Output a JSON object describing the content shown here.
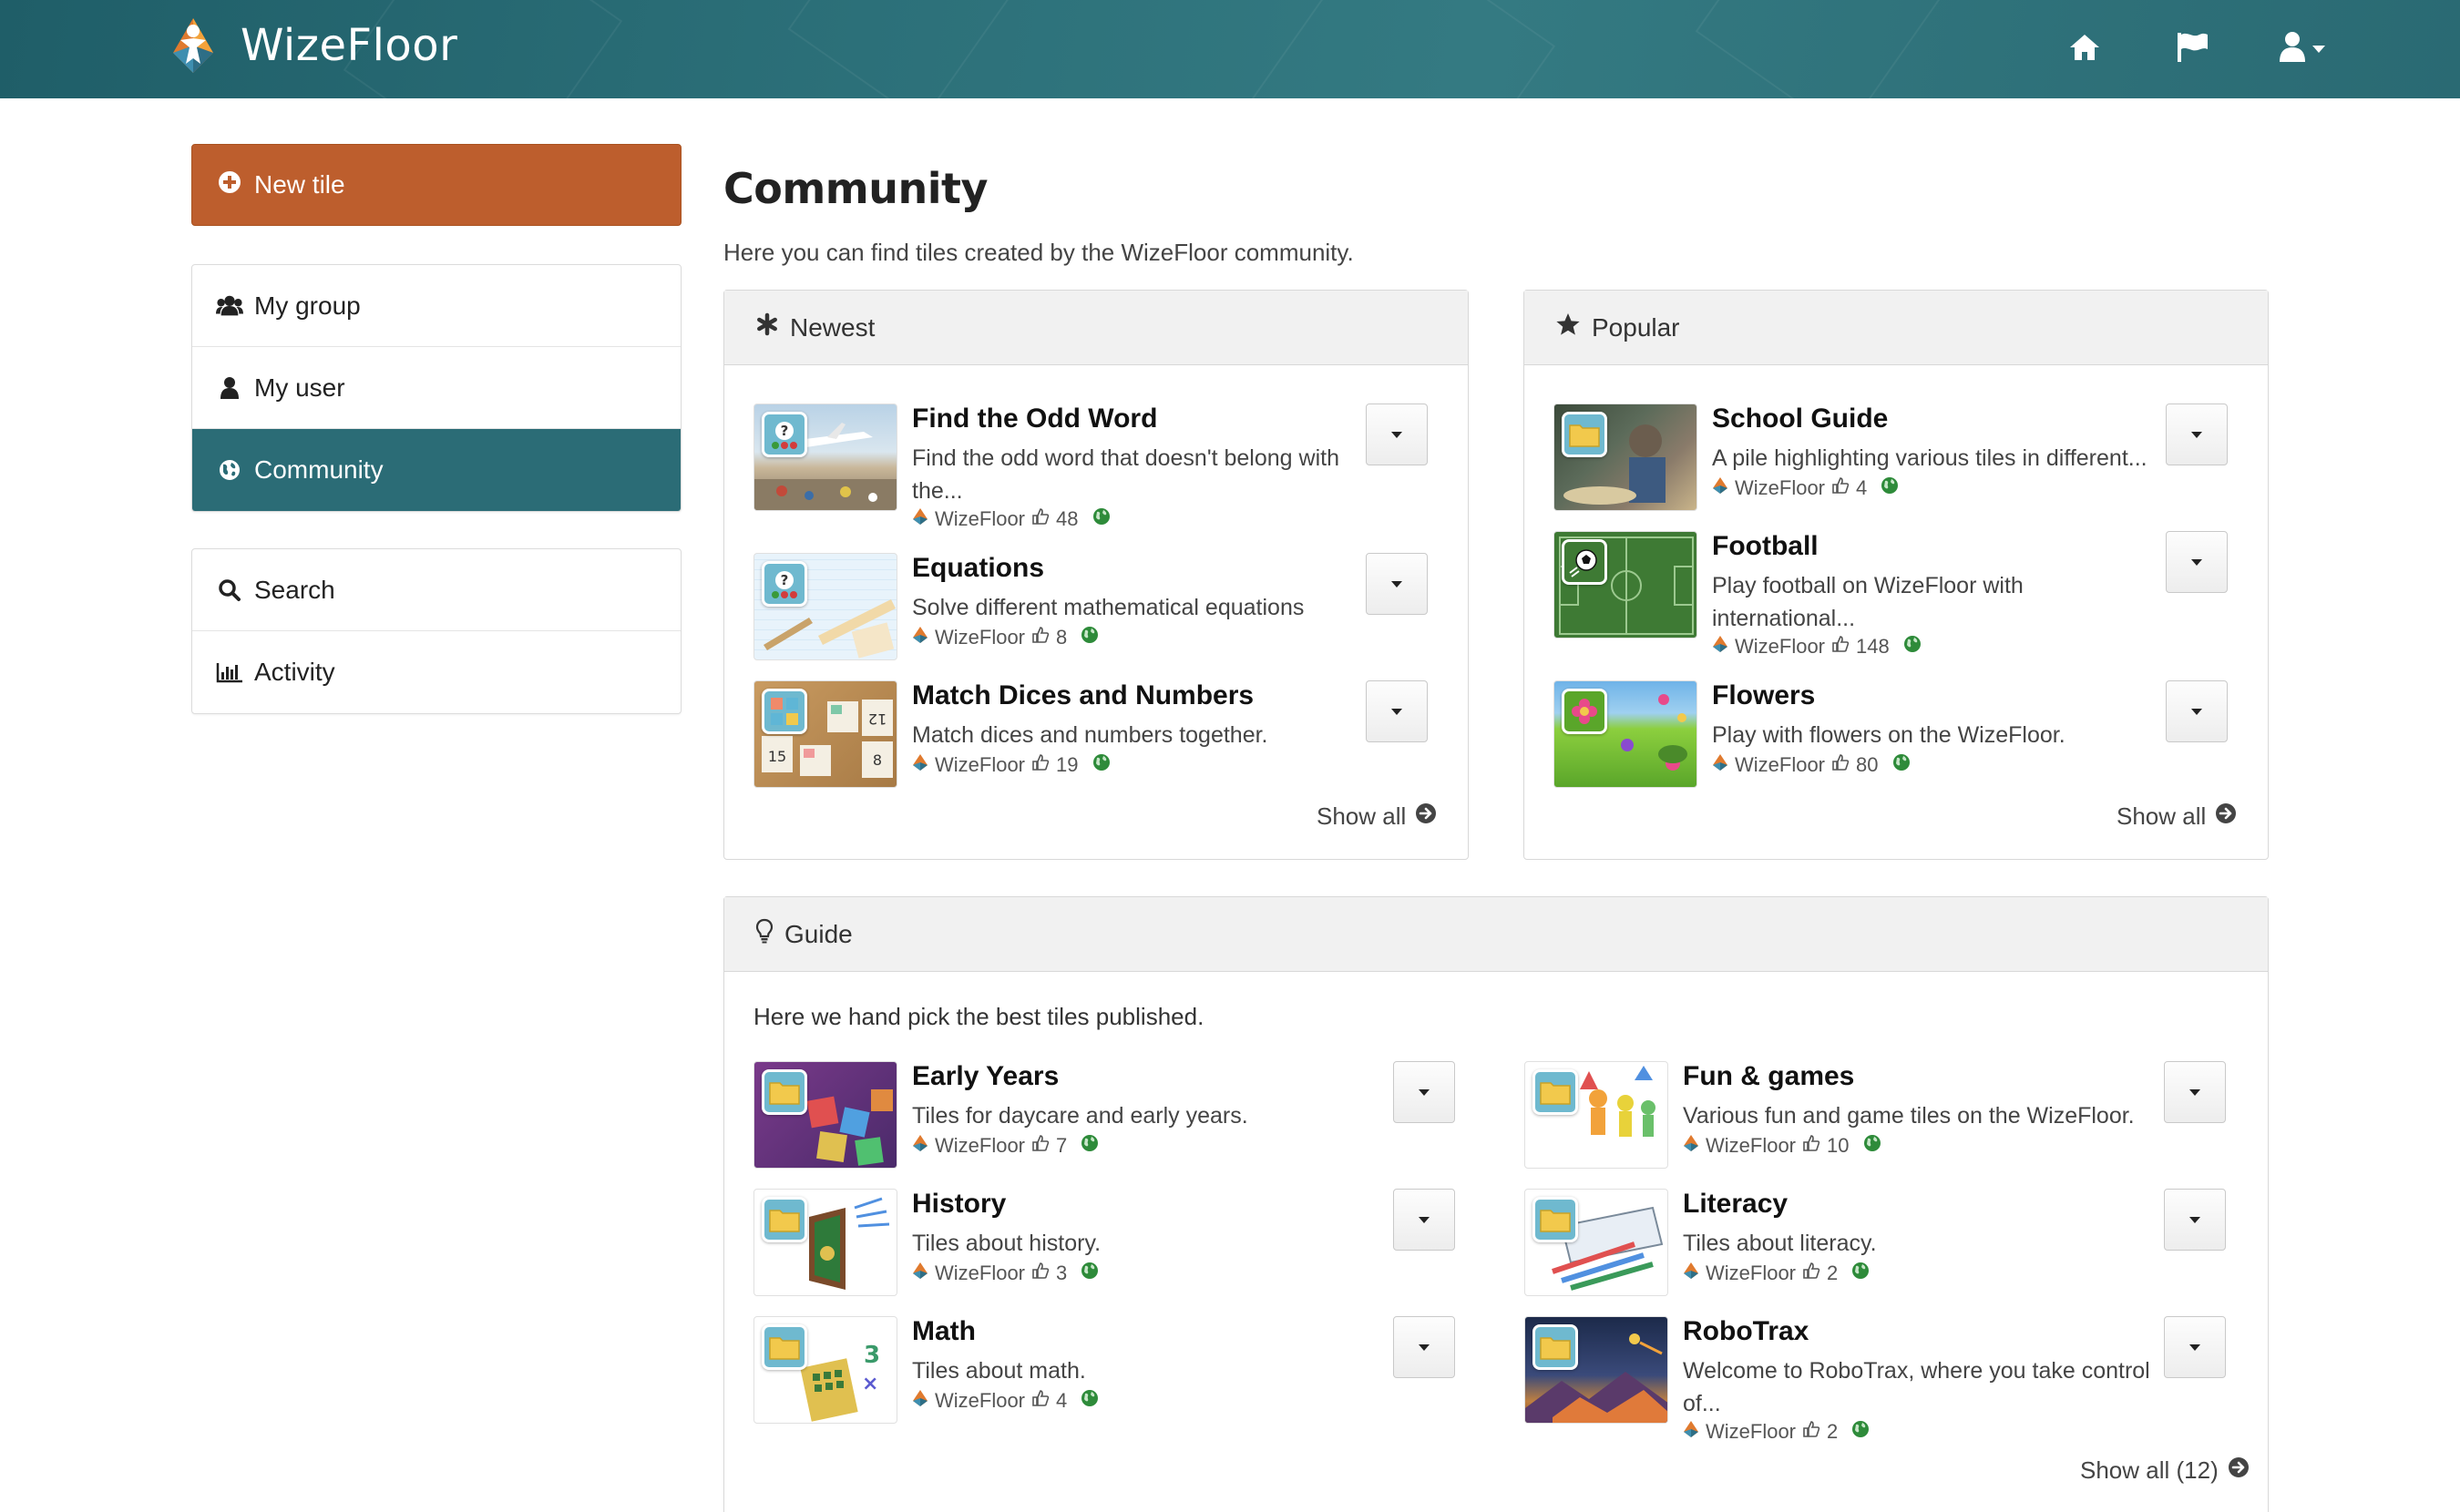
{
  "app": {
    "name": "WizeFloor"
  },
  "colors": {
    "accent": "#2b6c76",
    "new_tile": "#bd5e2d",
    "globe": "#2e8b3a"
  },
  "sidebar": {
    "new_tile_label": "New tile",
    "group1": [
      {
        "label": "My group",
        "icon": "users-icon"
      },
      {
        "label": "My user",
        "icon": "user-icon"
      },
      {
        "label": "Community",
        "icon": "globe-icon",
        "active": true
      }
    ],
    "group2": [
      {
        "label": "Search",
        "icon": "search-icon"
      },
      {
        "label": "Activity",
        "icon": "bar-chart-icon"
      }
    ]
  },
  "main": {
    "title": "Community",
    "subtitle": "Here you can find tiles created by the WizeFloor community.",
    "newest": {
      "heading": "Newest",
      "show_all": "Show all",
      "tiles": [
        {
          "title": "Find the Odd Word",
          "desc1": "Find the odd word that doesn't belong with",
          "desc2": "the...",
          "author": "WizeFloor",
          "likes": "48"
        },
        {
          "title": "Equations",
          "desc1": "Solve different mathematical equations",
          "author": "WizeFloor",
          "likes": "8"
        },
        {
          "title": "Match Dices and Numbers",
          "desc1": "Match dices and numbers together.",
          "author": "WizeFloor",
          "likes": "19"
        }
      ]
    },
    "popular": {
      "heading": "Popular",
      "show_all": "Show all",
      "tiles": [
        {
          "title": "School Guide",
          "desc1": "A pile highlighting various tiles in different...",
          "author": "WizeFloor",
          "likes": "4"
        },
        {
          "title": "Football",
          "desc1": "Play football on WizeFloor with",
          "desc2": "international...",
          "author": "WizeFloor",
          "likes": "148"
        },
        {
          "title": "Flowers",
          "desc1": "Play with flowers on the WizeFloor.",
          "author": "WizeFloor",
          "likes": "80"
        }
      ]
    },
    "guide": {
      "heading": "Guide",
      "intro": "Here we hand pick the best tiles published.",
      "show_all": "Show all (12)",
      "tiles": [
        {
          "title": "Early Years",
          "desc1": "Tiles for daycare and early years.",
          "author": "WizeFloor",
          "likes": "7"
        },
        {
          "title": "Fun & games",
          "desc1": "Various fun and game tiles on the WizeFloor.",
          "author": "WizeFloor",
          "likes": "10"
        },
        {
          "title": "History",
          "desc1": "Tiles about history.",
          "author": "WizeFloor",
          "likes": "3"
        },
        {
          "title": "Literacy",
          "desc1": "Tiles about literacy.",
          "author": "WizeFloor",
          "likes": "2"
        },
        {
          "title": "Math",
          "desc1": "Tiles about math.",
          "author": "WizeFloor",
          "likes": "4"
        },
        {
          "title": "RoboTrax",
          "desc1": "Welcome to RoboTrax, where you take control",
          "desc2": "of...",
          "author": "WizeFloor",
          "likes": "2"
        }
      ]
    }
  }
}
